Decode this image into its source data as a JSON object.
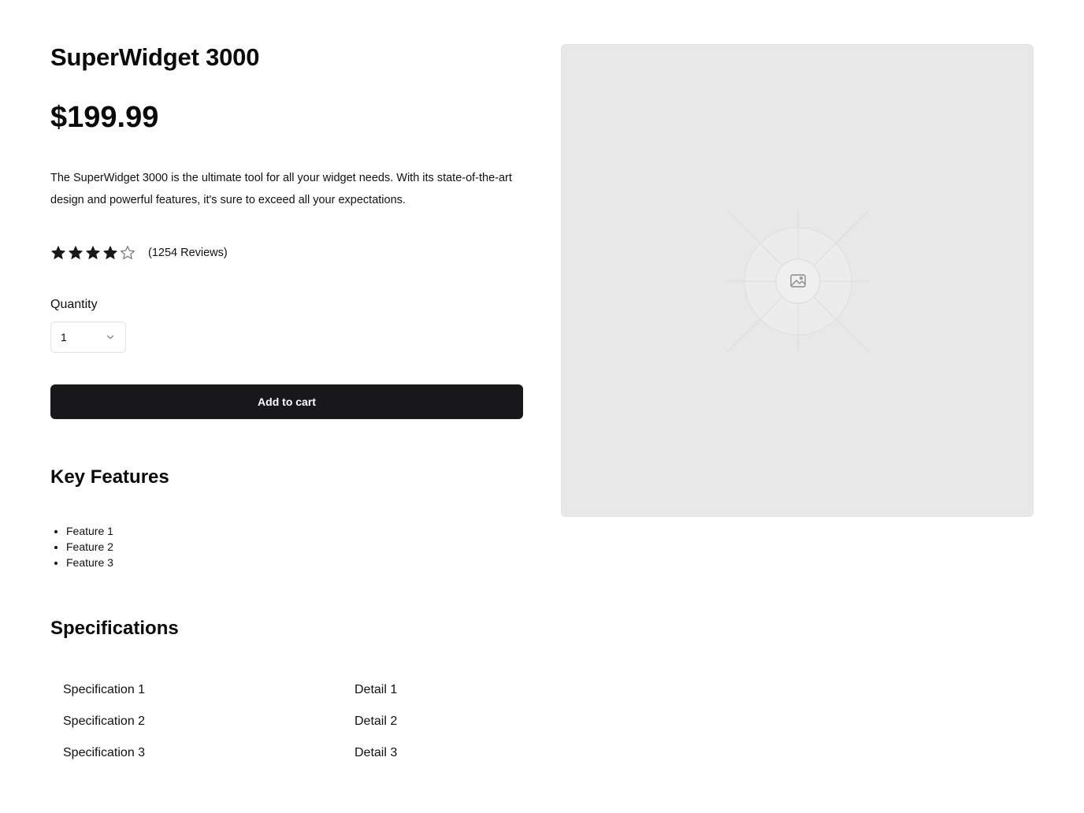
{
  "product": {
    "title": "SuperWidget 3000",
    "price": "$199.99",
    "description": "The SuperWidget 3000 is the ultimate tool for all your widget needs. With its state-of-the-art design and powerful features, it's sure to exceed all your expectations.",
    "rating": {
      "value": 4,
      "max": 5,
      "reviews_text": "(1254 Reviews)"
    },
    "image": {
      "icon": "image-placeholder-icon"
    }
  },
  "quantity": {
    "label": "Quantity",
    "selected": "1"
  },
  "cart": {
    "button_label": "Add to cart"
  },
  "features": {
    "heading": "Key Features",
    "items": [
      "Feature 1",
      "Feature 2",
      "Feature 3"
    ]
  },
  "specifications": {
    "heading": "Specifications",
    "rows": [
      {
        "name": "Specification 1",
        "detail": "Detail 1"
      },
      {
        "name": "Specification 2",
        "detail": "Detail 2"
      },
      {
        "name": "Specification 3",
        "detail": "Detail 3"
      }
    ]
  },
  "colors": {
    "button_bg": "#18181b",
    "star_filled": "#18181b",
    "star_empty": "#71717a",
    "image_bg": "#e8e8e8"
  }
}
